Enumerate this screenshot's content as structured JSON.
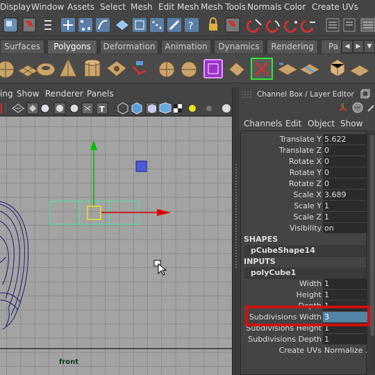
{
  "menubar": {
    "items": [
      "Display",
      "Window",
      "Assets",
      "Select",
      "Mesh",
      "Edit Mesh",
      "Mesh Tools",
      "Normals",
      "Color",
      "Create UVs"
    ]
  },
  "shelf_tabs": {
    "items": [
      "Surfaces",
      "Polygons",
      "Deformation",
      "Animation",
      "Dynamics",
      "Rendering",
      "Pa"
    ],
    "active": "Polygons"
  },
  "viewport": {
    "menu": [
      "ing",
      "Show",
      "Renderer",
      "Panels"
    ],
    "label": "front"
  },
  "channel_box": {
    "title": "Channel Box / Layer Editor",
    "menu": [
      "Channels",
      "Edit",
      "Object",
      "Show"
    ],
    "attributes": [
      {
        "label": "Translate Y",
        "value": "5.622"
      },
      {
        "label": "Translate Z",
        "value": "0"
      },
      {
        "label": "Rotate X",
        "value": "0"
      },
      {
        "label": "Rotate Y",
        "value": "0"
      },
      {
        "label": "Rotate Z",
        "value": "0"
      },
      {
        "label": "Scale X",
        "value": "3.689"
      },
      {
        "label": "Scale Y",
        "value": "1"
      },
      {
        "label": "Scale Z",
        "value": "1"
      },
      {
        "label": "Visibility",
        "value": "on"
      }
    ],
    "shapes_header": "SHAPES",
    "shape_node": "pCubeShape14",
    "inputs_header": "INPUTS",
    "input_node": "polyCube1",
    "input_attributes": [
      {
        "label": "Width",
        "value": "1"
      },
      {
        "label": "Height",
        "value": "1"
      },
      {
        "label": "Depth",
        "value": "1"
      },
      {
        "label": "Subdivisions Width",
        "value": "3"
      },
      {
        "label": "Subdivisions Height",
        "value": "1"
      },
      {
        "label": "Subdivisions Depth",
        "value": "1"
      },
      {
        "label": "Create UVs",
        "value": "Normalize ..."
      }
    ]
  },
  "colors": {
    "highlight_field": "#5285a6",
    "callout": "#d01010",
    "manip_x": "#e00000",
    "manip_y": "#00c000",
    "selection": "#40e8a0"
  }
}
